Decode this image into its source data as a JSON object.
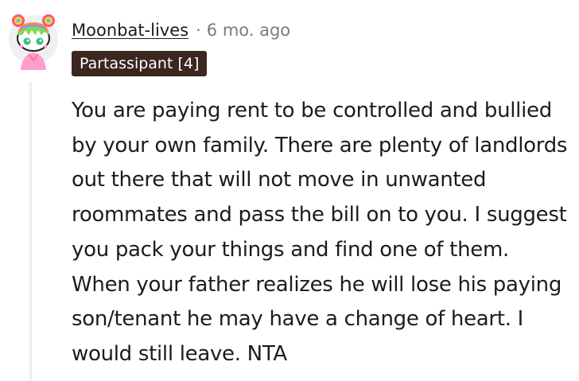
{
  "comment": {
    "username": "Moonbat-lives",
    "separator": "·",
    "timestamp": "6 mo. ago",
    "flair": "Partassipant [4]",
    "body": "You are paying rent to be controlled and bullied by your own family. There are plenty of landlords out there that will not move in unwanted roommates and pass the bill on to you. I suggest you pack your things and find one of them. When your father realizes he will lose his paying son/tenant he may have a change of heart. I would still leave. NTA",
    "avatar_icon": "snoo-avatar-rainbow-hair-icon"
  },
  "colors": {
    "text": "#1c1c1c",
    "muted": "#7c7c7c",
    "flair_background": "#3b2620",
    "flair_text": "#ffffff",
    "thread_line": "#eceef0"
  }
}
